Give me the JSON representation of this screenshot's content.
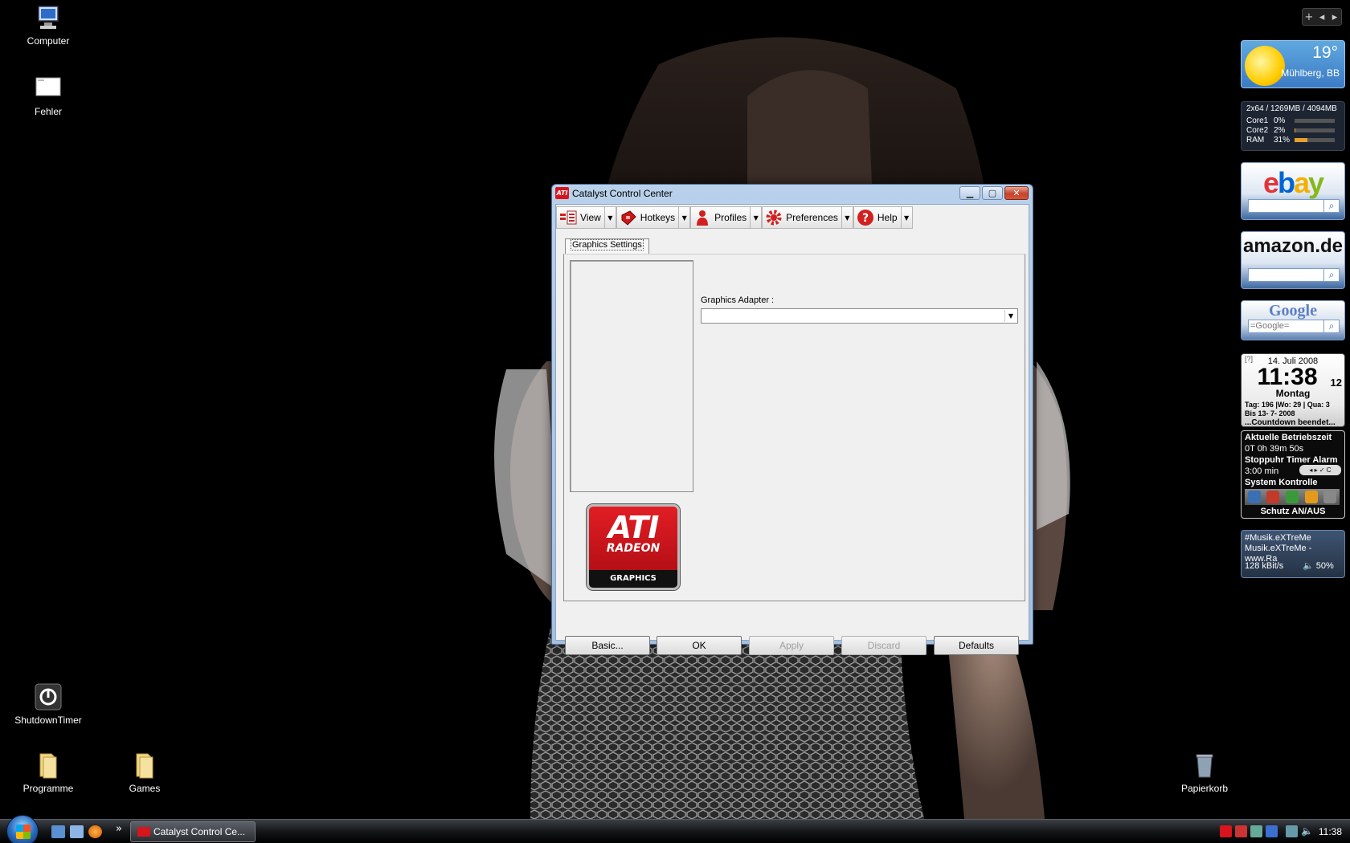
{
  "desktop": {
    "icons": [
      {
        "label": "Computer"
      },
      {
        "label": "Fehler"
      },
      {
        "label": "ShutdownTimer"
      },
      {
        "label": "Programme"
      },
      {
        "label": "Games"
      },
      {
        "label": "Papierkorb"
      }
    ]
  },
  "sidebar": {
    "controls": {
      "add": "+",
      "prev": "◂",
      "next": "▸"
    },
    "weather": {
      "temp": "19°",
      "city": "Mühlberg, BB"
    },
    "cpu": {
      "summary": "2x64 / 1269MB / 4094MB",
      "rows": [
        {
          "label": "Core1",
          "pct": "0%",
          "value": 0
        },
        {
          "label": "Core2",
          "pct": "2%",
          "value": 2
        },
        {
          "label": "RAM",
          "pct": "31%",
          "value": 31
        }
      ]
    },
    "ebay": {
      "logo": "ebay"
    },
    "amazon": {
      "logo": "amazon.de"
    },
    "google": {
      "logo": "Google",
      "placeholder": "=Google="
    },
    "clock": {
      "q": "[?]",
      "date": "14. Juli 2008",
      "time": "11:38",
      "seconds": "12",
      "weekday": "Montag",
      "info1": "Tag: 196 |Wo: 29 | Qua: 3",
      "info2": "Bis 13- 7- 2008",
      "countdown": "...Countdown beendet..."
    },
    "timer": {
      "uptime_label": "Aktuelle Betriebszeit",
      "uptime": "0T 0h 39m 50s",
      "modes": "Stoppuhr Timer Alarm",
      "duration": "3:00 min",
      "controls": "◂ ▸ ✓ C",
      "system": "System Kontrolle",
      "protect": "Schutz AN/AUS"
    },
    "radio": {
      "station": "#Musik.eXTreMe",
      "stream": "Musik.eXTreMe - www.Ra",
      "bitrate": "128 kBit/s",
      "volume": "50%"
    }
  },
  "window": {
    "title": "Catalyst Control Center",
    "app_icon": "ATI",
    "caption": {
      "minimize": "▁",
      "maximize": "▢",
      "close": "✕"
    },
    "toolbar": [
      {
        "label": "View"
      },
      {
        "label": "Hotkeys"
      },
      {
        "label": "Profiles"
      },
      {
        "label": "Preferences"
      },
      {
        "label": "Help"
      }
    ],
    "tab": "Graphics Settings",
    "adapter_label": "Graphics Adapter :",
    "adapter_value": "",
    "logo": {
      "ati": "ATI",
      "radeon": "RADEON",
      "graphics": "GRAPHICS"
    },
    "buttons": {
      "basic": "Basic...",
      "ok": "OK",
      "apply": "Apply",
      "discard": "Discard",
      "defaults": "Defaults"
    }
  },
  "taskbar": {
    "more": "»",
    "task": "Catalyst Control Ce...",
    "clock": "11:38"
  },
  "colors": {
    "ati_red": "#d8141d",
    "accent": "#3c7bc4",
    "desktop": "#000000"
  }
}
